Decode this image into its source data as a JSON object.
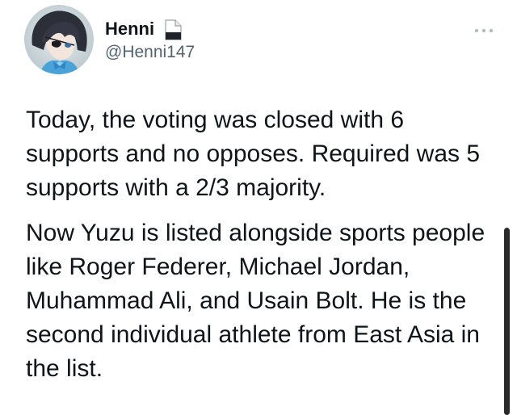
{
  "user": {
    "display_name": "Henni",
    "handle": "@Henni147"
  },
  "icons": {
    "more": "more-horizontal-icon",
    "name_badge": "document-icon"
  },
  "tweet": {
    "paragraphs": [
      "Today, the voting was closed with 6 supports and no opposes. Required was 5 supports with a 2/3 majority.",
      "Now Yuzu is listed alongside sports people like Roger Federer, Michael Jordan, Muhammad Ali, and Usain Bolt. He is the second individual athlete from East Asia in the list."
    ]
  },
  "colors": {
    "text": "#0f1419",
    "secondary_text": "#536471",
    "scrollbar": "#2a2a2a"
  }
}
